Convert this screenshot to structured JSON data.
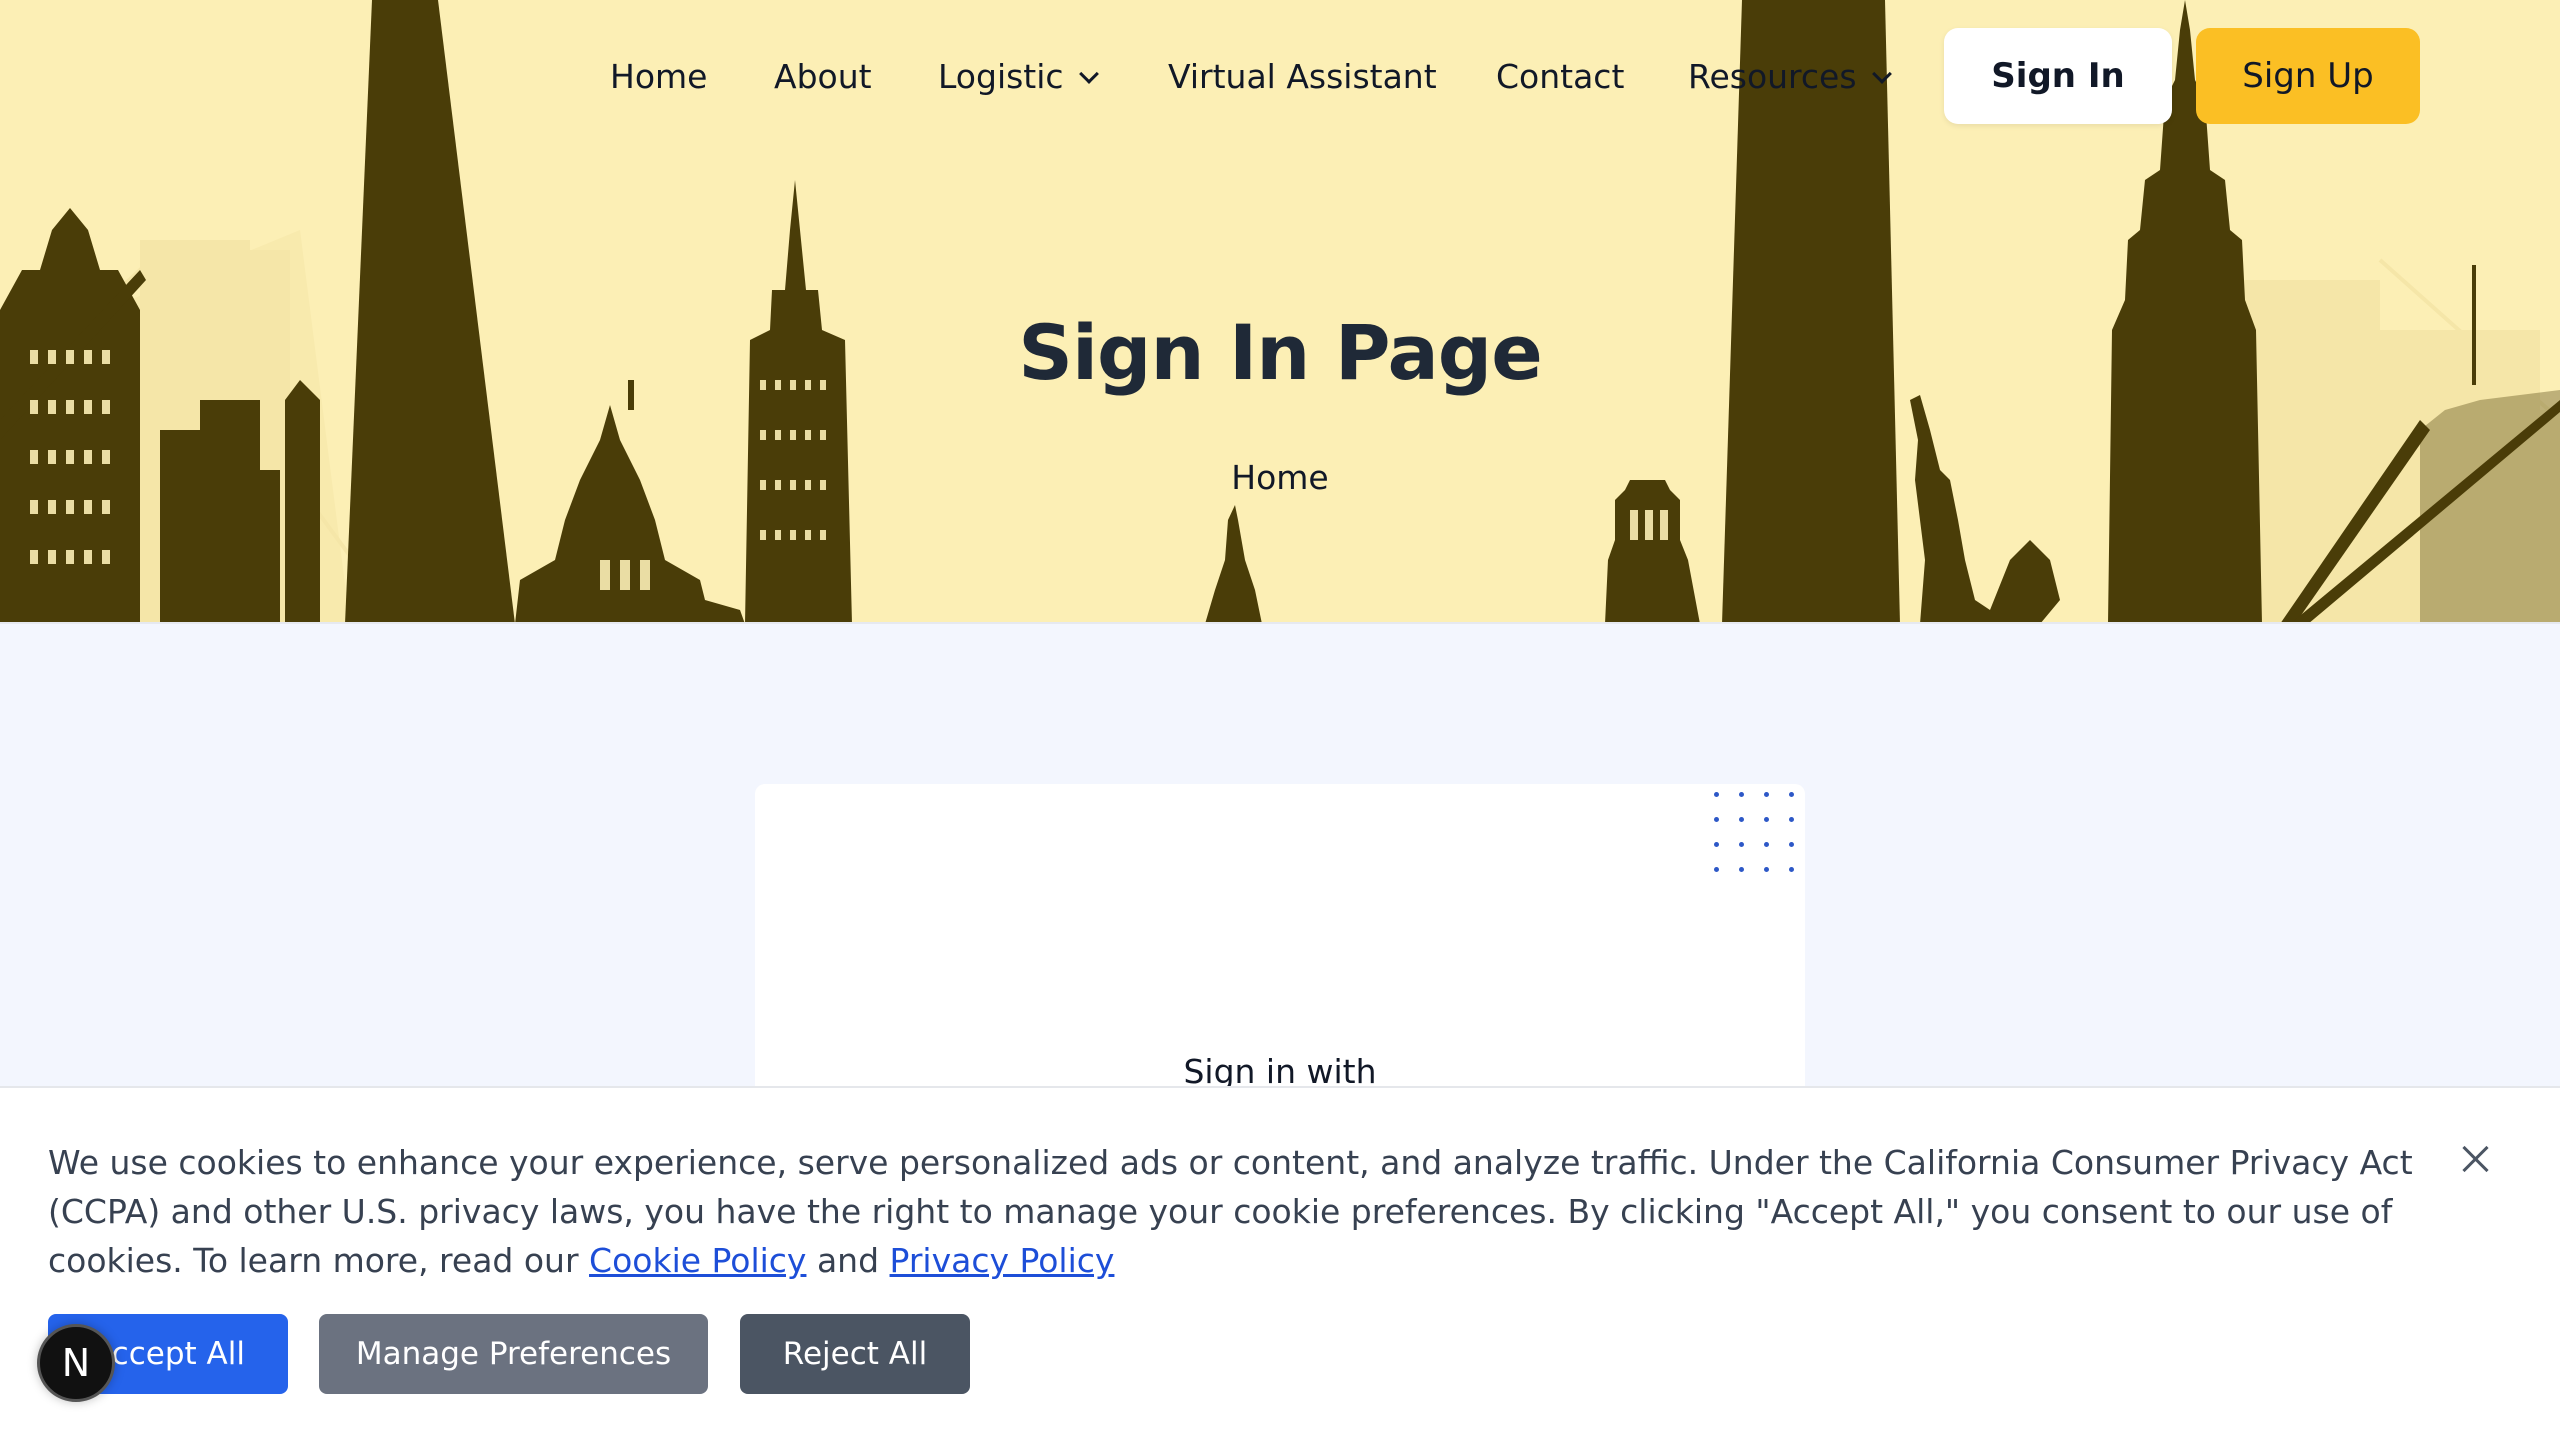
{
  "nav": {
    "items": [
      {
        "label": "Home"
      },
      {
        "label": "About"
      },
      {
        "label": "Logistic",
        "has_dropdown": true
      },
      {
        "label": "Virtual Assistant"
      },
      {
        "label": "Contact"
      },
      {
        "label": "Resources",
        "has_dropdown": true
      }
    ],
    "sign_in_label": "Sign In",
    "sign_up_label": "Sign Up"
  },
  "hero": {
    "title": "Sign In Page",
    "breadcrumb": "Home"
  },
  "card": {
    "sign_in_with": "Sign in with"
  },
  "cookie_banner": {
    "text": "We use cookies to enhance your experience, serve personalized ads or content, and analyze traffic. Under the California Consumer Privacy Act (CCPA) and other U.S. privacy laws, you have the right to manage your cookie preferences. By clicking \"Accept All,\" you consent to our use of cookies. To learn more, read our ",
    "cookie_policy_link": "Cookie Policy",
    "and_text": " and ",
    "privacy_policy_link": "Privacy Policy",
    "accept_label": "Accept All",
    "manage_label": "Manage Preferences",
    "reject_label": "Reject All",
    "close_icon": "close-icon"
  },
  "badge": {
    "letter": "N"
  },
  "colors": {
    "hero_bg": "#fcefb5",
    "skyline": "#4a3d08",
    "skyline_light": "#f5e6a8",
    "accent_yellow": "#fbbf24",
    "primary_blue": "#2563eb",
    "page_bg": "#f3f6fe"
  }
}
